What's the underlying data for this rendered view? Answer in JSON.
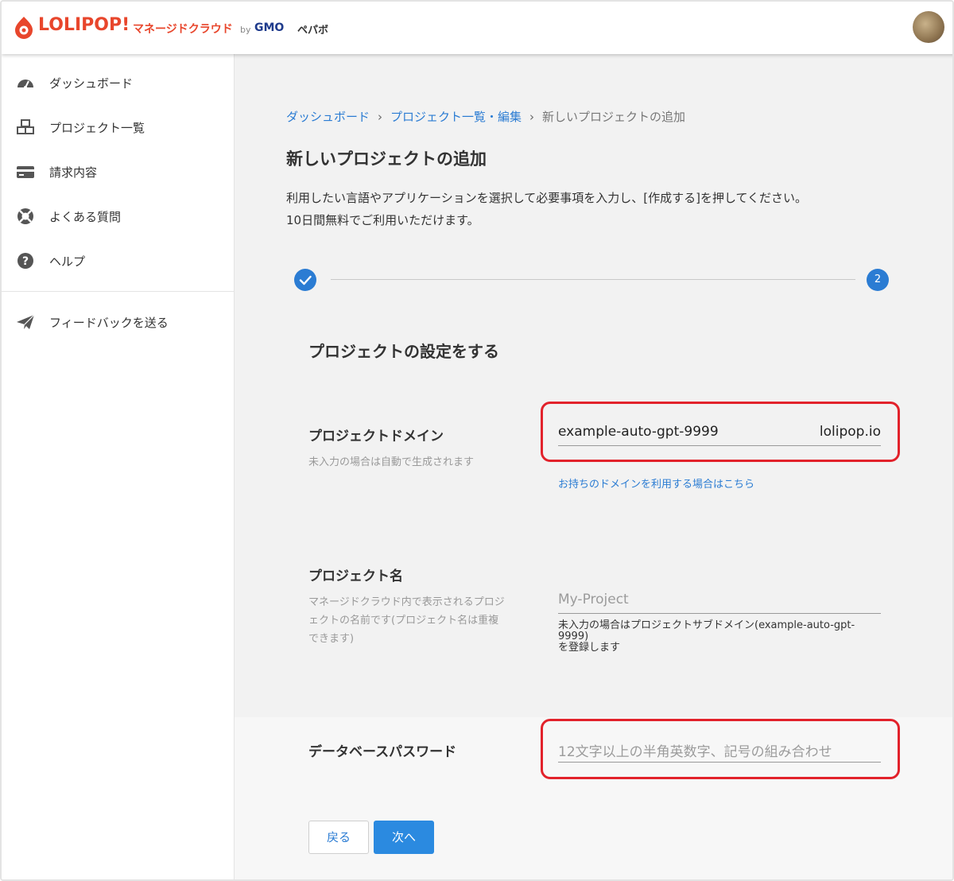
{
  "header": {
    "logo_text": "LOLIPOP!",
    "logo_subtitle": "マネージドクラウド",
    "logo_by": "by",
    "logo_gmo": "GMO",
    "logo_gmo_kana": "ペパボ",
    "brand_color": "#e8462c"
  },
  "sidebar": {
    "items": [
      {
        "label": "ダッシュボード",
        "icon": "dashboard-icon"
      },
      {
        "label": "プロジェクト一覧",
        "icon": "cubes-icon"
      },
      {
        "label": "請求内容",
        "icon": "credit-card-icon"
      },
      {
        "label": "よくある質問",
        "icon": "lifebuoy-icon"
      },
      {
        "label": "ヘルプ",
        "icon": "question-circle-icon"
      }
    ],
    "feedback_label": "フィードバックを送る"
  },
  "breadcrumb": {
    "items": [
      "ダッシュボード",
      "プロジェクト一覧・編集"
    ],
    "separator": "›",
    "current": "新しいプロジェクトの追加"
  },
  "page": {
    "title": "新しいプロジェクトの追加",
    "description_line1": "利用したい言語やアプリケーションを選択して必要事項を入力し、[作成する]を押してください。",
    "description_line2": "10日間無料でご利用いただけます。"
  },
  "stepper": {
    "current_step": "2",
    "accent_color": "#2b7cd3"
  },
  "form": {
    "section_title": "プロジェクトの設定をする",
    "domain": {
      "label": "プロジェクトドメイン",
      "hint": "未入力の場合は自動で生成されます",
      "value": "example-auto-gpt-9999",
      "suffix": "lolipop.io",
      "own_domain_link": "お持ちのドメインを利用する場合はこちら"
    },
    "name": {
      "label": "プロジェクト名",
      "hint_line1": "マネージドクラウド内で表示されるプロジ",
      "hint_line2": "ェクトの名前です(プロジェクト名は重複",
      "hint_line3": "できます)",
      "placeholder": "My-Project",
      "note_line1": "未入力の場合はプロジェクトサブドメイン(example-auto-gpt-9999)",
      "note_line2": "を登録します"
    },
    "password": {
      "label": "データベースパスワード",
      "placeholder": "12文字以上の半角英数字、記号の組み合わせ"
    }
  },
  "buttons": {
    "back": "戻る",
    "next": "次へ"
  },
  "highlight_color": "#e2222b"
}
